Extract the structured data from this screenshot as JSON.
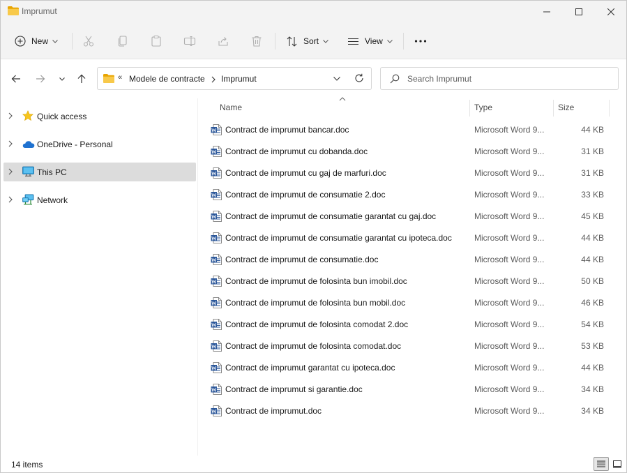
{
  "window": {
    "title": "Imprumut"
  },
  "toolbar": {
    "new_label": "New",
    "sort_label": "Sort",
    "view_label": "View",
    "more_label": "•••"
  },
  "address": {
    "overflow": "«",
    "crumbs": [
      "Modele de contracte",
      "Imprumut"
    ]
  },
  "search": {
    "placeholder": "Search Imprumut",
    "value": ""
  },
  "nav": {
    "items": [
      {
        "label": "Quick access",
        "icon": "star-icon",
        "selected": false
      },
      {
        "label": "OneDrive - Personal",
        "icon": "cloud-icon",
        "selected": false
      },
      {
        "label": "This PC",
        "icon": "monitor-icon",
        "selected": true
      },
      {
        "label": "Network",
        "icon": "network-icon",
        "selected": false
      }
    ]
  },
  "columns": {
    "name": "Name",
    "type": "Type",
    "size": "Size"
  },
  "files": [
    {
      "name": "Contract de imprumut bancar.doc",
      "type": "Microsoft Word 9...",
      "size": "44 KB"
    },
    {
      "name": "Contract de imprumut cu dobanda.doc",
      "type": "Microsoft Word 9...",
      "size": "31 KB"
    },
    {
      "name": "Contract de imprumut cu gaj de marfuri.doc",
      "type": "Microsoft Word 9...",
      "size": "31 KB"
    },
    {
      "name": "Contract de imprumut de consumatie 2.doc",
      "type": "Microsoft Word 9...",
      "size": "33 KB"
    },
    {
      "name": "Contract de imprumut de consumatie garantat cu gaj.doc",
      "type": "Microsoft Word 9...",
      "size": "45 KB"
    },
    {
      "name": "Contract de imprumut de consumatie garantat cu ipoteca.doc",
      "type": "Microsoft Word 9...",
      "size": "44 KB"
    },
    {
      "name": "Contract de imprumut de consumatie.doc",
      "type": "Microsoft Word 9...",
      "size": "44 KB"
    },
    {
      "name": "Contract de imprumut de folosinta bun imobil.doc",
      "type": "Microsoft Word 9...",
      "size": "50 KB"
    },
    {
      "name": "Contract de imprumut de folosinta bun mobil.doc",
      "type": "Microsoft Word 9...",
      "size": "46 KB"
    },
    {
      "name": "Contract de imprumut de folosinta comodat 2.doc",
      "type": "Microsoft Word 9...",
      "size": "54 KB"
    },
    {
      "name": "Contract de imprumut de folosinta comodat.doc",
      "type": "Microsoft Word 9...",
      "size": "53 KB"
    },
    {
      "name": "Contract de imprumut garantat cu ipoteca.doc",
      "type": "Microsoft Word 9...",
      "size": "44 KB"
    },
    {
      "name": "Contract de imprumut si garantie.doc",
      "type": "Microsoft Word 9...",
      "size": "34 KB"
    },
    {
      "name": "Contract de imprumut.doc",
      "type": "Microsoft Word 9...",
      "size": "34 KB"
    }
  ],
  "status": {
    "count": "14 items"
  },
  "colors": {
    "accent": "#0067c0",
    "folder": "#f5c542",
    "word": "#2b579a",
    "selection": "#dcdcdc"
  }
}
